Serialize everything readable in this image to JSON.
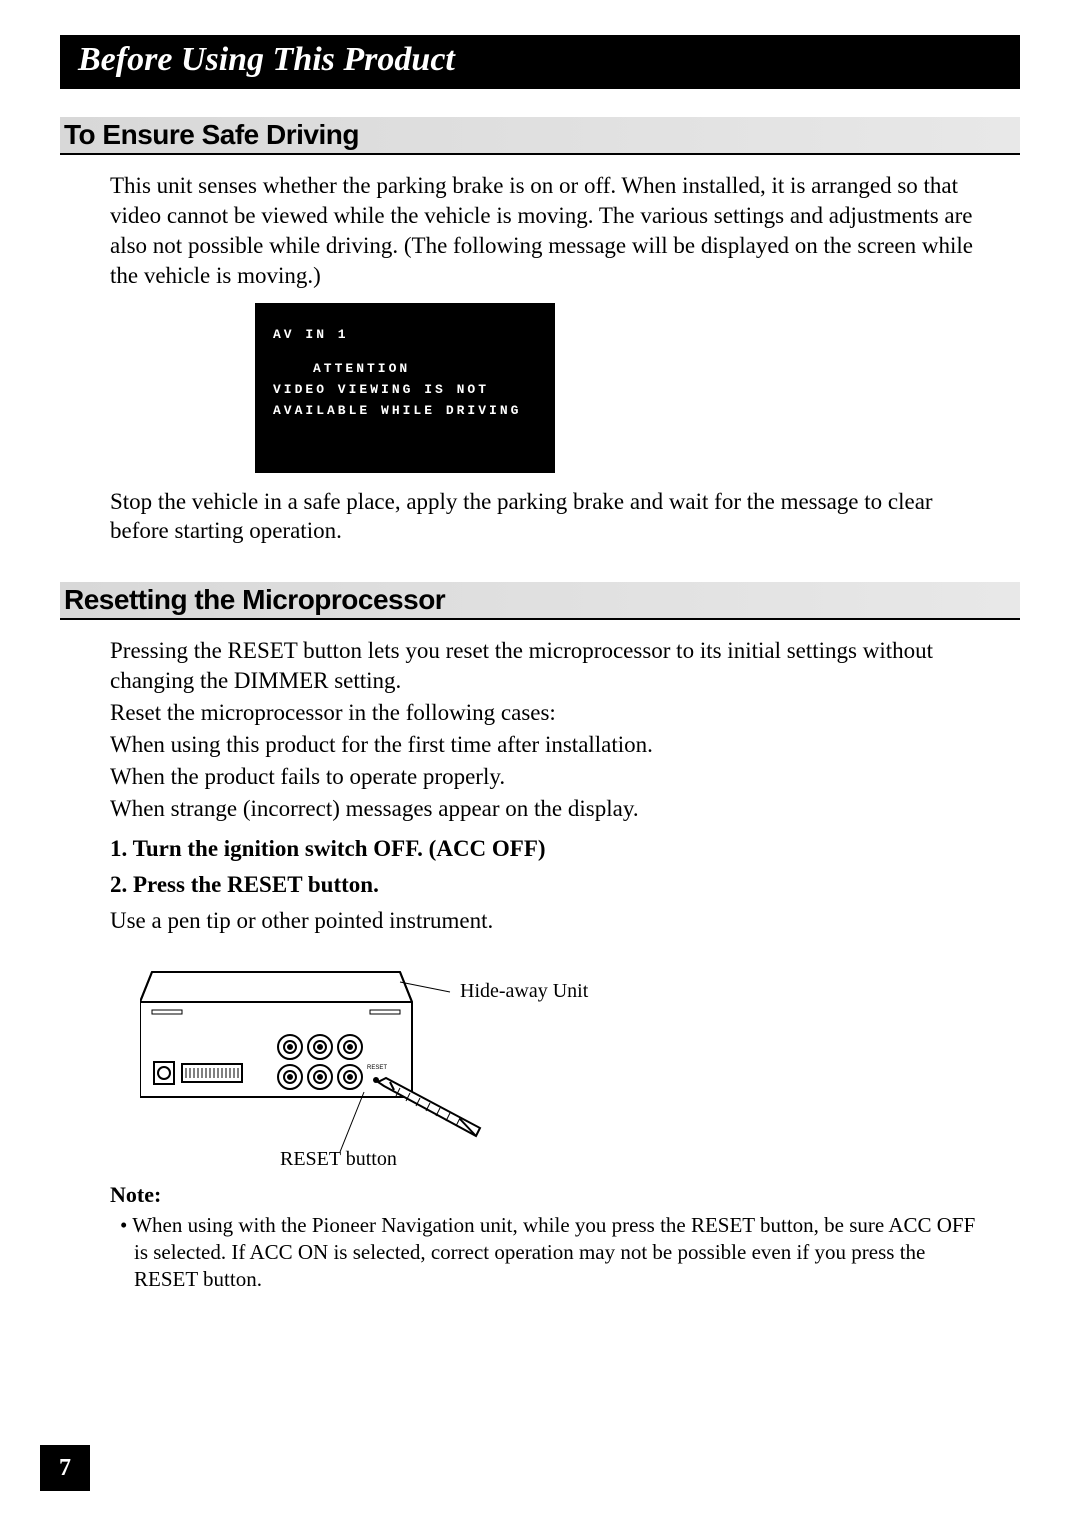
{
  "chapter": "Before Using This Product",
  "section1": {
    "heading": "To Ensure Safe Driving",
    "para1": "This unit senses whether the parking brake is on or off. When installed, it is arranged so that video cannot be viewed while the vehicle is moving. The various settings and adjustments are also not possible while driving. (The following message will be displayed on the screen while the vehicle is moving.)",
    "screen": {
      "line1": "AV IN 1",
      "line2": "ATTENTION",
      "line3": "VIDEO VIEWING IS NOT",
      "line4": "AVAILABLE WHILE DRIVING"
    },
    "para2": "Stop the vehicle in a safe place, apply the parking brake and wait for the message to clear before starting operation."
  },
  "section2": {
    "heading": "Resetting the Microprocessor",
    "para1": "Pressing the RESET button lets you reset the microprocessor to its initial settings without changing the DIMMER setting.",
    "para2": "Reset the microprocessor in the following cases:",
    "para3": "When using this product for the first time after installation.",
    "para4": "When the product fails to operate properly.",
    "para5": "When strange (incorrect) messages appear on the display.",
    "steps": [
      "Turn the ignition switch OFF. (ACC OFF)",
      "Press the RESET button."
    ],
    "step2_sub": "Use a pen tip or other pointed instrument.",
    "diagram": {
      "label_unit": "Hide-away Unit",
      "label_reset": "RESET button"
    },
    "note_heading": "Note:",
    "notes": [
      "When using with the Pioneer Navigation unit, while you press the RESET button, be sure ACC OFF is selected. If ACC ON is selected, correct operation may not be possible even if you press the RESET button."
    ]
  },
  "page_number": "7"
}
